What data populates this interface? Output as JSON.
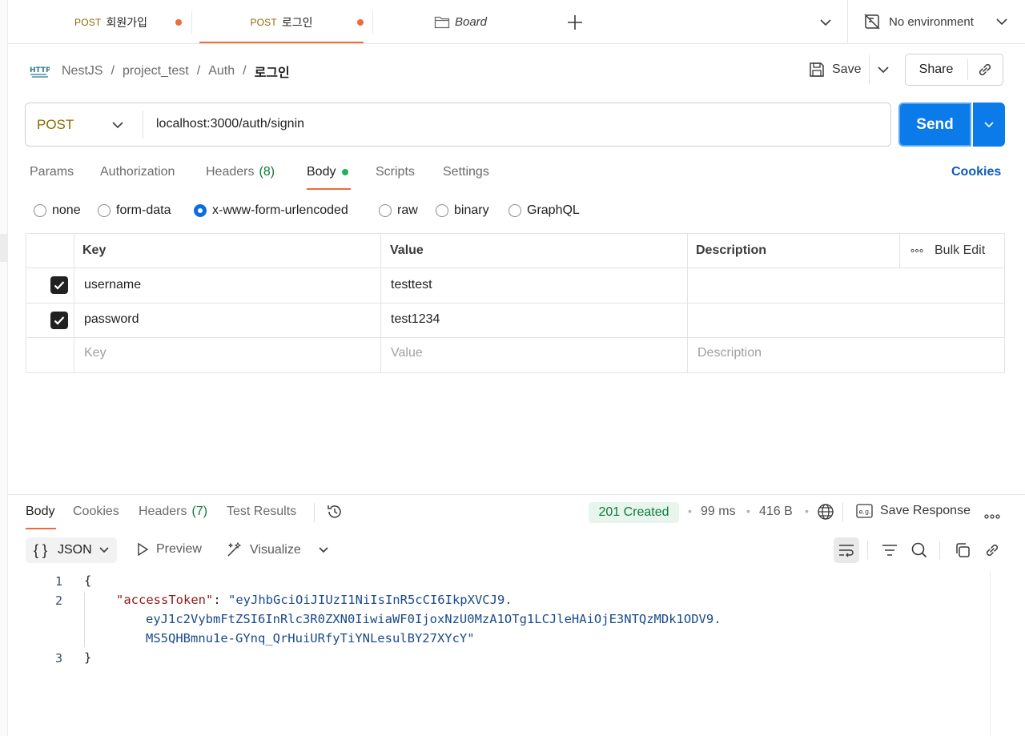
{
  "tabs": [
    {
      "method": "POST",
      "label": "회원가입",
      "unsaved": true
    },
    {
      "method": "POST",
      "label": "로그인",
      "unsaved": true,
      "active": true
    },
    {
      "label": "Board"
    }
  ],
  "environment": {
    "label": "No environment"
  },
  "breadcrumb": {
    "icon_label": "HTTP",
    "items": [
      "NestJS",
      "project_test",
      "Auth"
    ],
    "current": "로그인",
    "separator": "/"
  },
  "header_actions": {
    "save_label": "Save",
    "share_label": "Share"
  },
  "request": {
    "method": "POST",
    "url": "localhost:3000/auth/signin",
    "send_label": "Send"
  },
  "request_tabs": {
    "params": "Params",
    "authorization": "Authorization",
    "headers": "Headers",
    "headers_count": "(8)",
    "body": "Body",
    "scripts": "Scripts",
    "settings": "Settings",
    "cookies": "Cookies"
  },
  "body_types": {
    "options": [
      "none",
      "form-data",
      "x-www-form-urlencoded",
      "raw",
      "binary",
      "GraphQL"
    ],
    "selected": "x-www-form-urlencoded"
  },
  "params_table": {
    "headers": {
      "key": "Key",
      "value": "Value",
      "description": "Description",
      "bulk_edit": "Bulk Edit"
    },
    "rows": [
      {
        "checked": true,
        "key": "username",
        "value": "testtest",
        "description": ""
      },
      {
        "checked": true,
        "key": "password",
        "value": "test1234",
        "description": ""
      }
    ],
    "placeholders": {
      "key": "Key",
      "value": "Value",
      "description": "Description"
    }
  },
  "response": {
    "tabs": {
      "body": "Body",
      "cookies": "Cookies",
      "headers": "Headers",
      "headers_count": "(7)",
      "test_results": "Test Results"
    },
    "status": "201 Created",
    "time": "99 ms",
    "size": "416 B",
    "save_response": "Save Response",
    "format": "JSON",
    "preview": "Preview",
    "visualize": "Visualize",
    "line_numbers": [
      "1",
      "2",
      "3"
    ],
    "code": {
      "open_brace": "{",
      "key": "\"accessToken\"",
      "colon": ": ",
      "value_line1": "\"eyJhbGciOiJIUzI1NiIsInR5cCI6IkpXVCJ9.",
      "value_line2": "eyJ1c2VybmFtZSI6InRlc3R0ZXN0IiwiaWF0IjoxNzU0MzA1OTg1LCJleHAiOjE3NTQzMDk1ODV9.",
      "value_line3": "MS5QHBmnu1e-GYnq_QrHuiURfyTiYNLesulBY27XYcY\"",
      "close_brace": "}"
    }
  },
  "colors": {
    "accent": "#f06a3a",
    "send": "#0b7bea",
    "method": "#8a6a00",
    "status_ok_bg": "#e7f5ec",
    "status_ok_text": "#0c7a3a"
  }
}
